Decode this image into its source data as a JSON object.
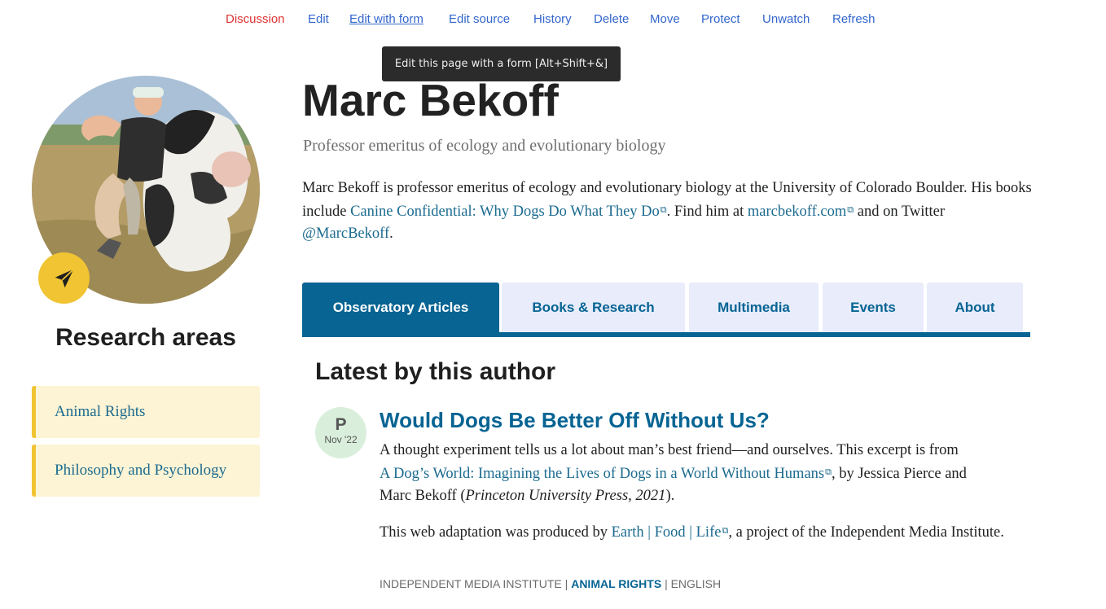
{
  "page_actions": {
    "items": [
      "Discussion",
      "Edit",
      "Edit with form",
      "Edit source",
      "History",
      "Delete",
      "Move",
      "Protect",
      "Unwatch",
      "Refresh"
    ],
    "active": "Discussion",
    "hovered": "Edit with form"
  },
  "tooltip": {
    "text": "Edit this page with a form [Alt+Shift+&]"
  },
  "profile": {
    "name": "Marc Bekoff",
    "subtitle": "Professor emeritus of ecology and evolutionary biology",
    "avatar_icon": "person-with-cow-photo",
    "badge_icon": "paper-plane-icon",
    "bio": {
      "text_1": "Marc Bekoff is professor emeritus of ecology and evolutionary biology at the University of Colorado Boulder. His books include ",
      "link_book": "Canine Confidential: Why Dogs Do What They Do",
      "text_2": ". Find him at ",
      "link_site": "marcbekoff.com",
      "text_3": " and on Twitter ",
      "link_twitter": "@MarcBekoff",
      "text_4": "."
    }
  },
  "research": {
    "title": "Research areas",
    "items": [
      "Animal Rights",
      "Philosophy and Psychology"
    ]
  },
  "tabs": {
    "items": [
      "Observatory Articles",
      "Books & Research",
      "Multimedia",
      "Events",
      "About"
    ],
    "active": "Observatory Articles"
  },
  "latest": {
    "heading": "Latest by this author",
    "article": {
      "badge_letter": "P",
      "badge_date": "Nov '22",
      "title": "Would Dogs Be Better Off Without Us?",
      "p1_text_1": "A thought experiment tells us a lot about man’s best friend—and ourselves. This excerpt is from",
      "p1_link": "A Dog’s World: Imagining the Lives of Dogs in a World Without Humans",
      "p1_text_2": ", by Jessica Pierce and",
      "p1_text_3": "Marc Bekoff (",
      "p1_italic": "Princeton University Press, 2021",
      "p1_text_4": ").",
      "p2_text_1": "This web adaptation was produced by ",
      "p2_link": "Earth | Food | Life",
      "p2_text_2": ", a project of the Independent Media Institute.",
      "meta_source": "INDEPENDENT MEDIA INSTITUTE",
      "meta_tag": "ANIMAL RIGHTS",
      "meta_lang": "ENGLISH"
    }
  },
  "colors": {
    "link": "#1c6b8f",
    "tab_active": "#076493",
    "tab_inactive": "#e8ecfb",
    "accent_yellow": "#f1c433",
    "research_bg": "#fdf4d5",
    "date_badge_bg": "#d9efdb",
    "action_link": "#3366cc",
    "action_active": "#dd3333"
  }
}
